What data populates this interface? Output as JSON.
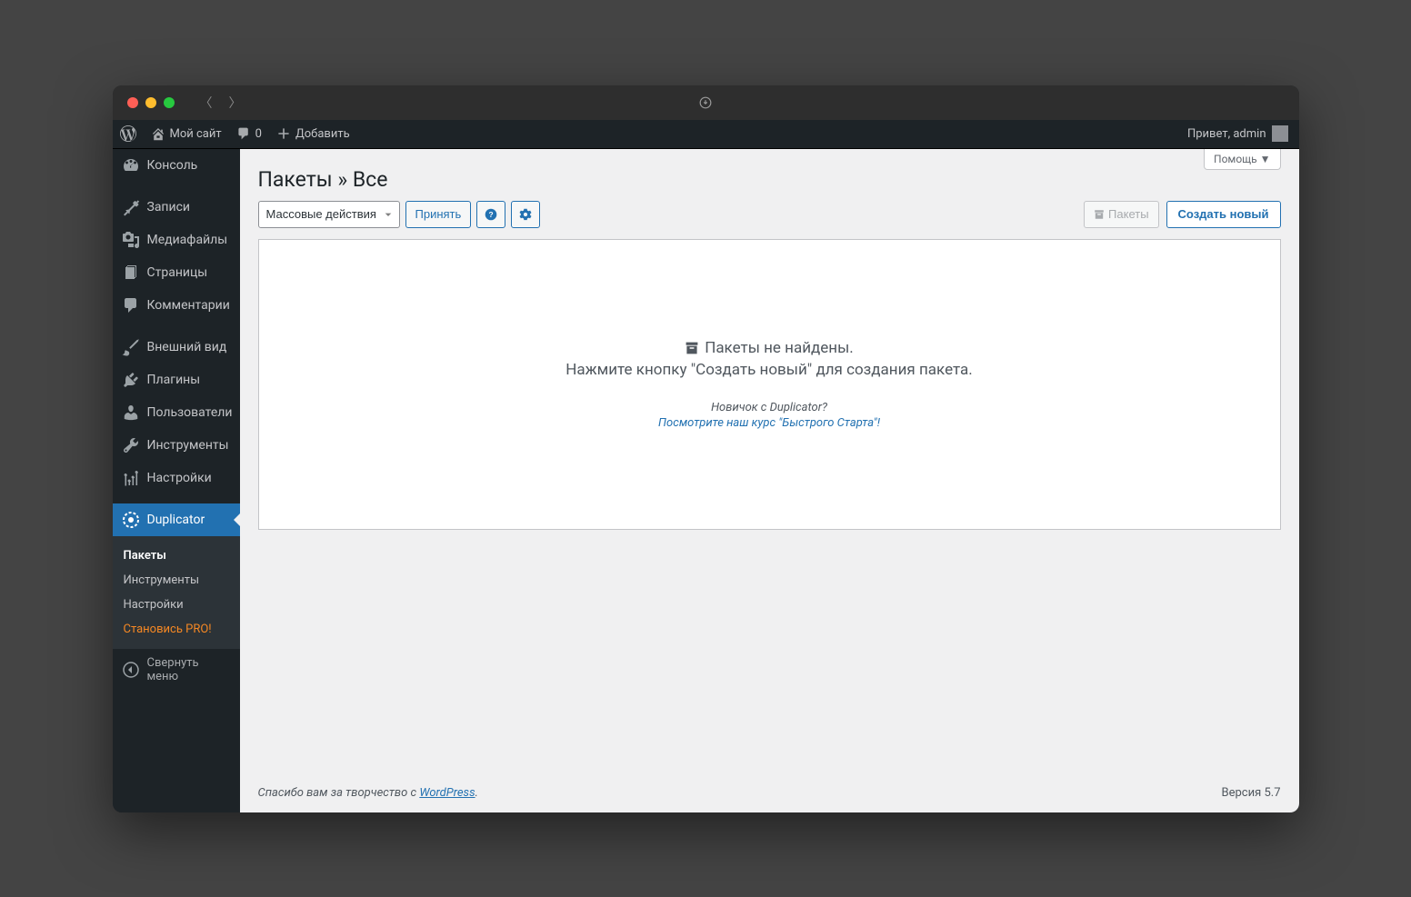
{
  "adminbar": {
    "site_title": "Мой сайт",
    "comments_count": "0",
    "add_new": "Добавить",
    "greeting": "Привет, admin"
  },
  "sidebar": {
    "console": "Консоль",
    "posts": "Записи",
    "media": "Медиафайлы",
    "pages": "Страницы",
    "comments": "Комментарии",
    "appearance": "Внешний вид",
    "plugins": "Плагины",
    "users": "Пользователи",
    "tools": "Инструменты",
    "settings": "Настройки",
    "duplicator": "Duplicator",
    "collapse": "Свернуть меню",
    "submenu": {
      "packages": "Пакеты",
      "tools": "Инструменты",
      "settings": "Настройки",
      "pro": "Становись PRO!"
    }
  },
  "page": {
    "title": "Пакеты » Все",
    "help": "Помощь",
    "bulk_actions": "Массовые действия",
    "apply": "Принять",
    "packages_btn": "Пакеты",
    "create_new": "Создать новый",
    "empty_title": "Пакеты не найдены.",
    "empty_subtitle": "Нажмите кнопку \"Создать новый\" для создания пакета.",
    "helper_text": "Новичок с Duplicator?",
    "helper_link": "Посмотрите наш курс \"Быстрого Старта\"!"
  },
  "footer": {
    "thanks_prefix": "Спасибо вам за творчество с ",
    "wp_link": "WordPress",
    "version": "Версия 5.7"
  }
}
